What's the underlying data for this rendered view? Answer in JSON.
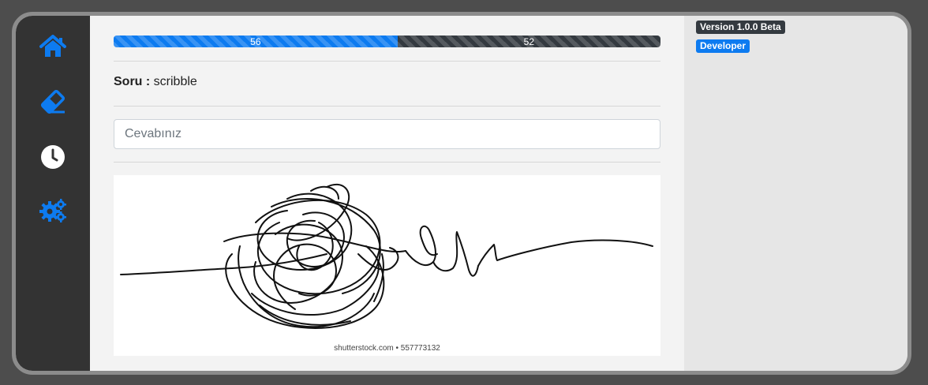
{
  "sidebar": {
    "items": [
      {
        "icon": "home-icon"
      },
      {
        "icon": "eraser-icon"
      },
      {
        "icon": "clock-icon"
      },
      {
        "icon": "gears-icon"
      }
    ],
    "accent_color": "#0d7bf0"
  },
  "progress": {
    "correct": "56",
    "wrong": "52",
    "correct_fraction": 0.519,
    "colors": {
      "correct": "#0d7bf0",
      "wrong": "#343a40"
    }
  },
  "question": {
    "label": "Soru :",
    "text": "scribble"
  },
  "answer": {
    "placeholder": "Cevabınız",
    "value": ""
  },
  "image": {
    "subject": "scribble drawing",
    "watermark": "shutterstock.com • 557773132"
  },
  "badges": {
    "version": "Version 1.0.0 Beta",
    "role": "Developer"
  }
}
